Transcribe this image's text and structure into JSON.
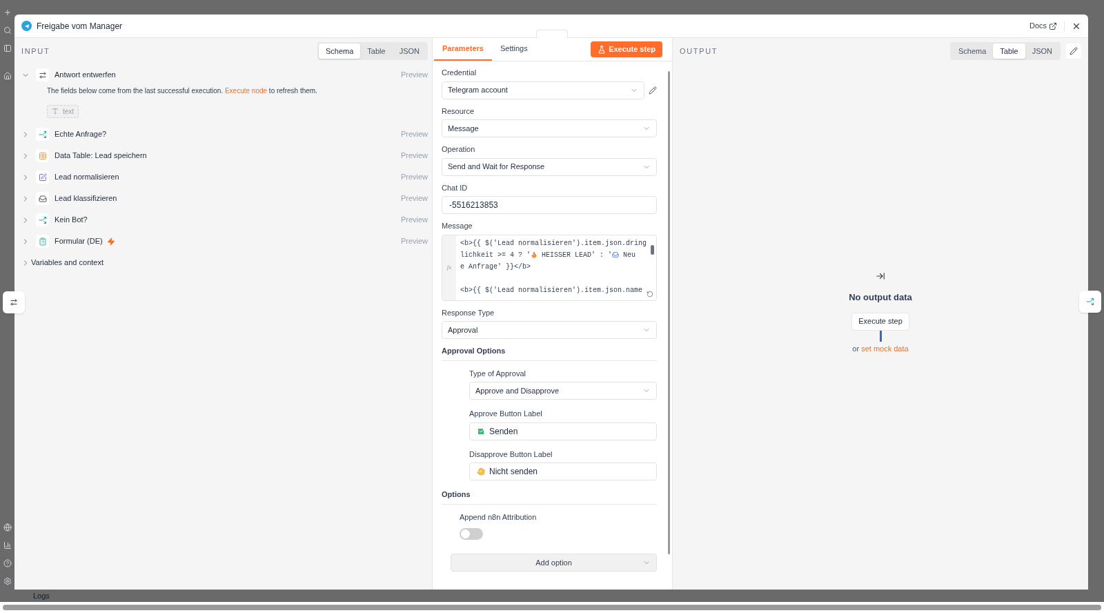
{
  "window": {
    "title": "Freigabe vom Manager",
    "docs_label": "Docs"
  },
  "input": {
    "heading": "INPUT",
    "view_tabs": [
      {
        "label": "Schema",
        "selected": true
      },
      {
        "label": "Table",
        "selected": false
      },
      {
        "label": "JSON",
        "selected": false
      }
    ],
    "nodes": [
      {
        "name": "Antwort entwerfen",
        "kind": "agent",
        "expanded": true,
        "trigger": false,
        "preview": "Preview",
        "notice": {
          "before": "The fields below come from the last successful execution.",
          "link": "Execute node",
          "after": "to refresh them."
        },
        "fields": [
          {
            "name": "text"
          }
        ]
      },
      {
        "name": "Echte Anfrage?",
        "kind": "branch",
        "expanded": false,
        "trigger": false,
        "preview": "Preview"
      },
      {
        "name": "Data Table: Lead speichern",
        "kind": "table",
        "expanded": false,
        "trigger": false,
        "preview": "Preview"
      },
      {
        "name": "Lead normalisieren",
        "kind": "edit",
        "expanded": false,
        "trigger": false,
        "preview": "Preview"
      },
      {
        "name": "Lead klassifizieren",
        "kind": "classify",
        "expanded": false,
        "trigger": false,
        "preview": "Preview"
      },
      {
        "name": "Kein Bot?",
        "kind": "branch",
        "expanded": false,
        "trigger": false,
        "preview": "Preview"
      },
      {
        "name": "Formular (DE)",
        "kind": "form",
        "expanded": false,
        "trigger": true,
        "preview": "Preview"
      }
    ],
    "variables": {
      "label": "Variables and context",
      "expanded": false
    }
  },
  "parameters": {
    "tabs": [
      {
        "label": "Parameters",
        "selected": true
      },
      {
        "label": "Settings",
        "selected": false
      }
    ],
    "execute_label": "Execute step",
    "fields": [
      {
        "kind": "select",
        "label": "Credential",
        "value": "Telegram account",
        "editable": true
      },
      {
        "kind": "select",
        "label": "Resource",
        "value": "Message"
      },
      {
        "kind": "select",
        "label": "Operation",
        "value": "Send and Wait for Response"
      },
      {
        "kind": "input",
        "label": "Chat ID",
        "value": "-5516213853"
      },
      {
        "kind": "code",
        "label": "Message",
        "marker": "fx",
        "lines": [
          {
            "kind": "code",
            "segments": [
              {
                "kind": "text",
                "t": "<b>{{ $('Lead normalisieren').item.json.dring"
              }
            ]
          },
          {
            "kind": "code",
            "segments": [
              {
                "kind": "text",
                "t": "lichkeit >= 4 ? '"
              },
              {
                "kind": "flame"
              },
              {
                "kind": "text",
                "t": " HEISSER LEAD' : '"
              },
              {
                "kind": "tray"
              },
              {
                "kind": "text",
                "t": " Neu"
              }
            ]
          },
          {
            "kind": "code",
            "segments": [
              {
                "kind": "text",
                "t": "e Anfrage' }}</b>"
              }
            ]
          },
          {
            "kind": "blank"
          },
          {
            "kind": "code",
            "segments": [
              {
                "kind": "text",
                "t": "<b>{{ $('Lead normalisieren').item.json.name"
              }
            ]
          }
        ]
      },
      {
        "kind": "select",
        "label": "Response Type",
        "value": "Approval"
      },
      {
        "kind": "section",
        "label": "Approval Options",
        "children": [
          {
            "kind": "select",
            "label": "Type of Approval",
            "value": "Approve and Disapprove"
          },
          {
            "kind": "check_input",
            "label": "Approve Button Label",
            "value": "Senden"
          },
          {
            "kind": "hand_input",
            "label": "Disapprove Button Label",
            "value": "Nicht senden"
          }
        ]
      },
      {
        "kind": "section",
        "label": "Options",
        "children": [
          {
            "kind": "toggle",
            "label": "Append n8n Attribution",
            "on": false
          }
        ]
      },
      {
        "kind": "add_option",
        "label": "Add option"
      }
    ]
  },
  "output": {
    "heading": "OUTPUT",
    "view_tabs": [
      {
        "label": "Schema",
        "selected": false
      },
      {
        "label": "Table",
        "selected": true
      },
      {
        "label": "JSON",
        "selected": false
      }
    ],
    "empty": {
      "title": "No output data",
      "button": "Execute step",
      "or_text": "or",
      "link": "set mock data"
    }
  },
  "logs": {
    "label": "Logs"
  }
}
